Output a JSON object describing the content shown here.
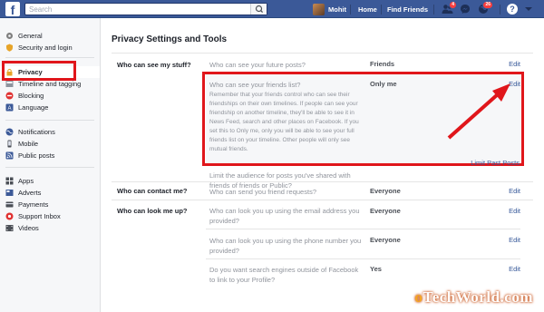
{
  "topbar": {
    "logo": "f",
    "search_placeholder": "Search",
    "user_name": "Mohit",
    "home": "Home",
    "find_friends": "Find Friends",
    "friend_badge": "4",
    "notif_badge": "26"
  },
  "sidebar": {
    "group1": [
      {
        "label": "General",
        "icon": "gear-icon"
      },
      {
        "label": "Security and login",
        "icon": "shield-icon"
      }
    ],
    "group2": [
      {
        "label": "Privacy",
        "icon": "lock-icon",
        "active": true
      },
      {
        "label": "Timeline and tagging",
        "icon": "timeline-icon"
      },
      {
        "label": "Blocking",
        "icon": "block-icon"
      },
      {
        "label": "Language",
        "icon": "globe-icon"
      }
    ],
    "group3": [
      {
        "label": "Notifications",
        "icon": "globe-notification-icon"
      },
      {
        "label": "Mobile",
        "icon": "mobile-icon"
      },
      {
        "label": "Public posts",
        "icon": "rss-icon"
      }
    ],
    "group4": [
      {
        "label": "Apps",
        "icon": "apps-icon"
      },
      {
        "label": "Adverts",
        "icon": "adverts-icon"
      },
      {
        "label": "Payments",
        "icon": "card-icon"
      },
      {
        "label": "Support Inbox",
        "icon": "lifebuoy-icon"
      },
      {
        "label": "Videos",
        "icon": "video-icon"
      }
    ]
  },
  "main": {
    "title": "Privacy Settings and Tools",
    "sections": {
      "stuff": "Who can see my stuff?",
      "contact": "Who can contact me?",
      "lookup": "Who can look me up?"
    },
    "rows": {
      "future_posts": {
        "q": "Who can see your future posts?",
        "val": "Friends",
        "action": "Edit"
      },
      "friends_list": {
        "q": "Who can see your friends list?",
        "val": "Only me",
        "action": "Edit",
        "desc": "Remember that your friends control who can see their friendships on their own timelines. If people can see your friendship on another timeline, they'll be able to see it in News Feed, search and other places on Facebook. If you set this to Only me, only you will be able to see your full friends list on your timeline. Other people will only see mutual friends."
      },
      "limit_past": {
        "q": "Limit the audience for posts you've shared with friends of friends or Public?",
        "action": "Limit Past Posts"
      },
      "friend_requests": {
        "q": "Who can send you friend requests?",
        "val": "Everyone",
        "action": "Edit"
      },
      "email_lookup": {
        "q": "Who can look you up using the email address you provided?",
        "val": "Everyone",
        "action": "Edit"
      },
      "phone_lookup": {
        "q": "Who can look you up using the phone number you provided?",
        "val": "Everyone",
        "action": "Edit"
      },
      "search_engines": {
        "q": "Do you want search engines outside of Facebook to link to your Profile?",
        "val": "Yes",
        "action": "Edit"
      }
    }
  },
  "watermark": {
    "o": "o",
    "rest": "TechWorld.com"
  },
  "colors": {
    "brand": "#3b5998",
    "highlight": "#e0161b",
    "link": "#365899"
  }
}
